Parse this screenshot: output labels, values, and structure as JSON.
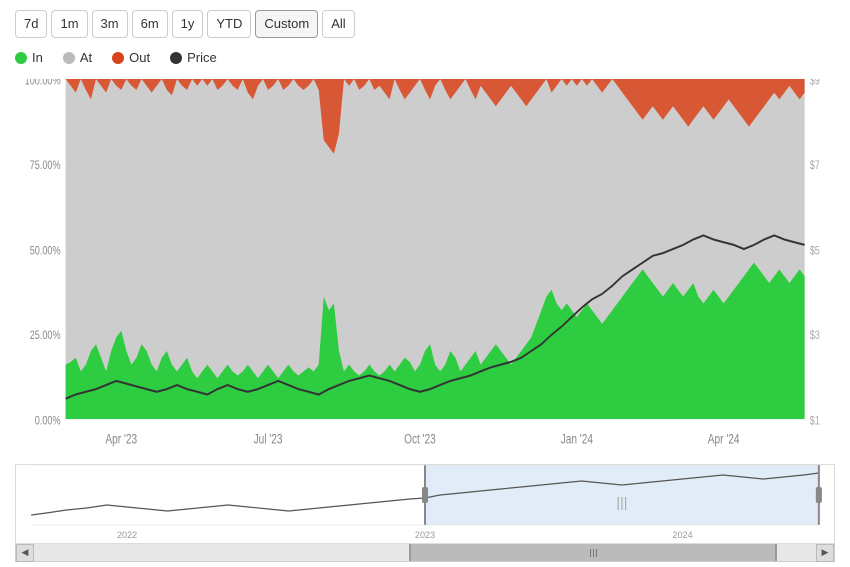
{
  "timeButtons": [
    {
      "label": "7d",
      "id": "7d",
      "active": false
    },
    {
      "label": "1m",
      "id": "1m",
      "active": false
    },
    {
      "label": "3m",
      "id": "3m",
      "active": false
    },
    {
      "label": "6m",
      "id": "6m",
      "active": false
    },
    {
      "label": "1y",
      "id": "1y",
      "active": false
    },
    {
      "label": "YTD",
      "id": "ytd",
      "active": false
    },
    {
      "label": "Custom",
      "id": "custom",
      "active": true
    },
    {
      "label": "All",
      "id": "all",
      "active": false
    }
  ],
  "legend": [
    {
      "label": "In",
      "color": "#2ecc40",
      "id": "in"
    },
    {
      "label": "At",
      "color": "#bbb",
      "id": "at"
    },
    {
      "label": "Out",
      "color": "#d9431a",
      "id": "out"
    },
    {
      "label": "Price",
      "color": "#333",
      "id": "price"
    }
  ],
  "chart": {
    "yAxisLabels": [
      "100.00%",
      "75.00%",
      "50.00%",
      "25.00%",
      "0.00%"
    ],
    "priceLabels": [
      "$9",
      "$7",
      "$5",
      "$3",
      "$1"
    ],
    "xAxisLabels": [
      "Apr '23",
      "Jul '23",
      "Oct '23",
      "Jan '24",
      "Apr '24"
    ],
    "colors": {
      "in": "#2ecc40",
      "at": "#c8c8c8",
      "out": "#d9431a",
      "price": "#333"
    }
  },
  "navigator": {
    "xLabels": [
      "2022",
      "2023",
      "2024"
    ]
  }
}
